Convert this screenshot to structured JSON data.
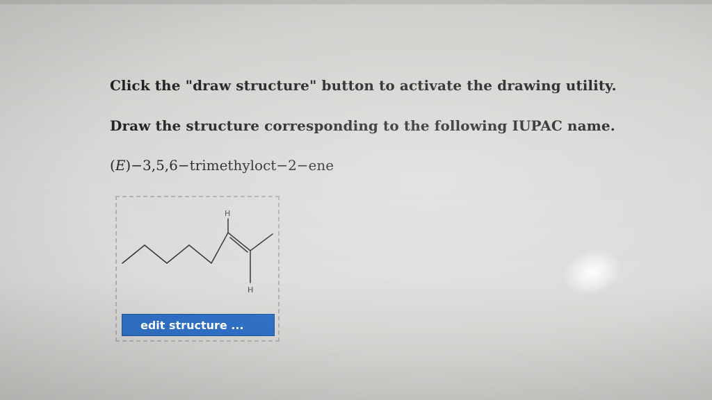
{
  "instructions": {
    "line1": "Click the \"draw structure\" button to activate the drawing utility.",
    "line2": "Draw the structure corresponding to the following IUPAC name."
  },
  "iupac_name": {
    "prefix_open": "(",
    "stereo": "E",
    "rest": ")−3,5,6−trimethyloct−2−ene"
  },
  "structure": {
    "atom_label_top": "H",
    "atom_label_bottom": "H"
  },
  "edit_button": {
    "label": "edit structure ..."
  },
  "colors": {
    "button": "#2f6fc4",
    "text": "#222222"
  }
}
